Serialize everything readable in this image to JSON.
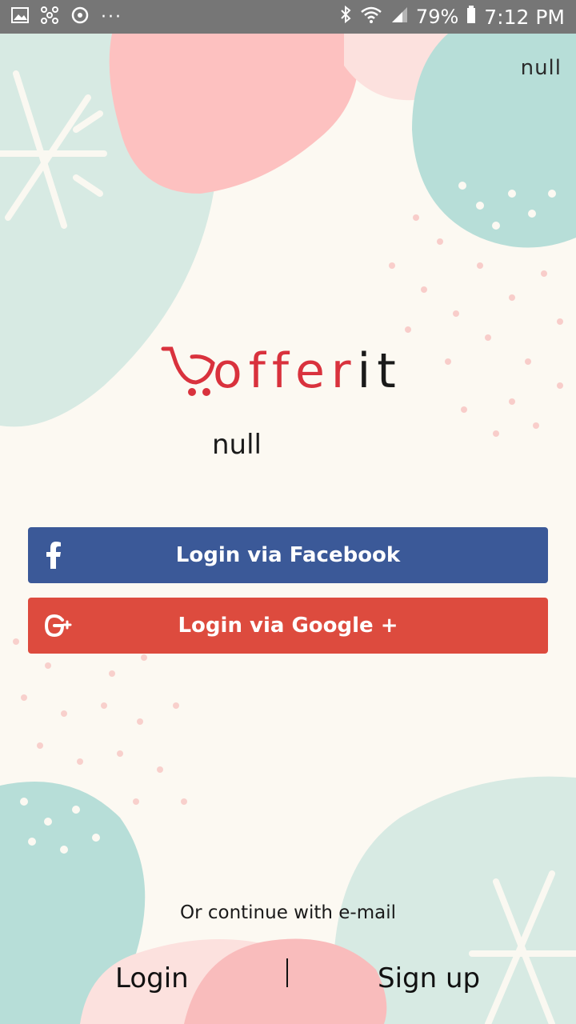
{
  "status_bar": {
    "battery": "79%",
    "time": "7:12 PM",
    "icons": [
      "image-icon",
      "pinwheel-icon",
      "sync-icon",
      "more-dots-icon",
      "bluetooth-icon",
      "wifi-icon",
      "signal-icon",
      "battery-icon"
    ]
  },
  "header": {
    "top_right_text": "null"
  },
  "logo": {
    "text_red": "offer",
    "text_dark": "it",
    "brand_red": "#D9323D"
  },
  "subtitle": "null",
  "buttons": {
    "facebook": {
      "label": "Login via Facebook",
      "color": "#3B5998",
      "icon": "facebook-icon"
    },
    "google": {
      "label": "Login via Google +",
      "color": "#DD4B3E",
      "icon": "google-plus-icon"
    }
  },
  "footer": {
    "or_text": "Or continue with e-mail",
    "login_label": "Login",
    "signup_label": "Sign up"
  }
}
